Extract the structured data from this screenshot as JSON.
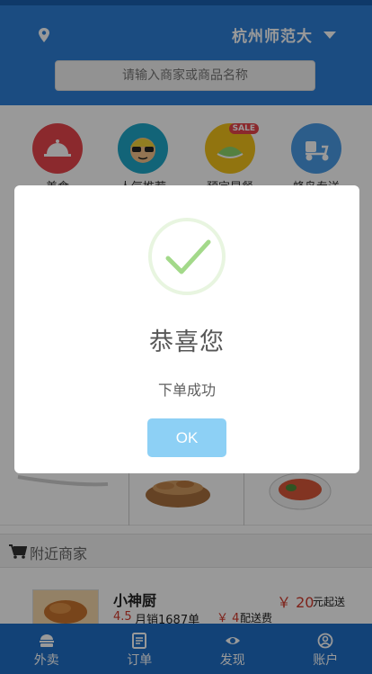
{
  "header": {
    "city": "杭州师范大",
    "search_placeholder": "请输入商家或商品名称"
  },
  "categories": [
    {
      "label": "美食",
      "icon": "cloche-icon",
      "color": "#e8454b"
    },
    {
      "label": "人气推荐",
      "icon": "face-icon",
      "color": "#1fa7c8"
    },
    {
      "label": "预定早餐",
      "icon": "breakfast-sale-icon",
      "color": "#f2c21a",
      "badge": "SALE"
    },
    {
      "label": "蜂鸟专送",
      "icon": "delivery-scooter-icon",
      "color": "#4a9be6"
    }
  ],
  "nearby": {
    "title": "附近商家"
  },
  "shop": {
    "name": "小神厨",
    "rating": "4.5",
    "sales": "月销1687单",
    "min_price": "￥ 20",
    "min_price_unit": "元起送",
    "fee": "￥ 4",
    "fee_unit": "配送费"
  },
  "bottom_nav": [
    {
      "label": "外卖",
      "icon": "takeout-icon"
    },
    {
      "label": "订单",
      "icon": "order-icon"
    },
    {
      "label": "发现",
      "icon": "eye-icon"
    },
    {
      "label": "账户",
      "icon": "account-icon"
    }
  ],
  "dialog": {
    "title": "恭喜您",
    "message": "下单成功",
    "ok_label": "OK",
    "check_color": "#a3d98a"
  }
}
